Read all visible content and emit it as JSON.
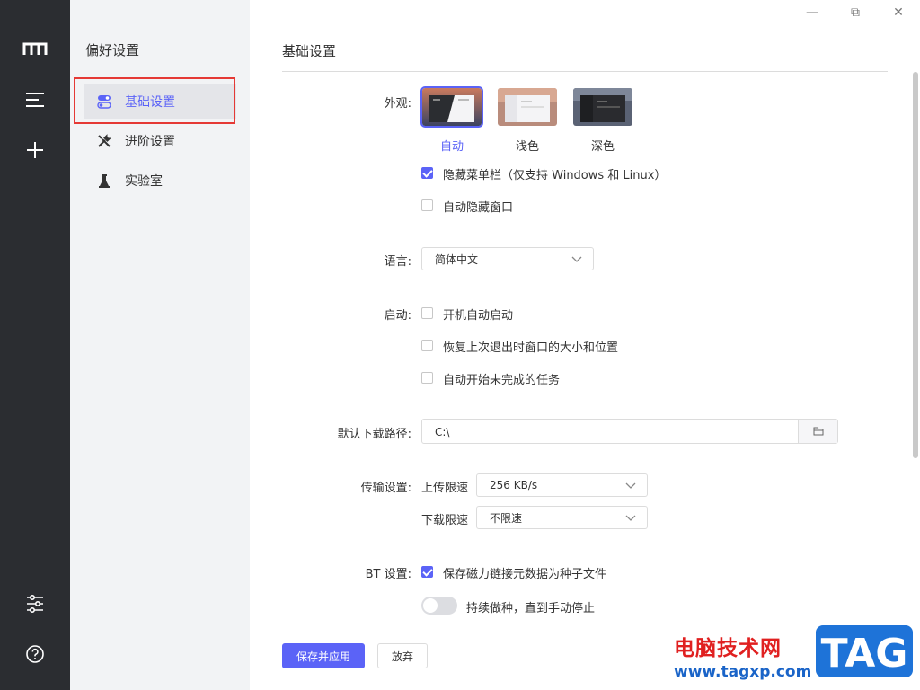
{
  "window": {
    "minimize_glyph": "—",
    "maximize_glyph": "⧉",
    "close_glyph": "✕"
  },
  "rail": {
    "icons": [
      "logo-icon",
      "menu-icon",
      "add-icon",
      "settings-sliders-icon",
      "help-icon"
    ]
  },
  "sidebar": {
    "title": "偏好设置",
    "items": [
      {
        "label": "基础设置",
        "icon": "toggle-icon",
        "active": true
      },
      {
        "label": "进阶设置",
        "icon": "tools-icon",
        "active": false
      },
      {
        "label": "实验室",
        "icon": "flask-icon",
        "active": false
      }
    ]
  },
  "main": {
    "title": "基础设置",
    "appearance": {
      "label": "外观:",
      "themes": [
        {
          "label": "自动",
          "selected": true
        },
        {
          "label": "浅色",
          "selected": false
        },
        {
          "label": "深色",
          "selected": false
        }
      ],
      "hide_menubar": {
        "label": "隐藏菜单栏（仅支持 Windows 和 Linux）",
        "checked": true
      },
      "auto_hide_window": {
        "label": "自动隐藏窗口",
        "checked": false
      }
    },
    "language": {
      "label": "语言:",
      "value": "简体中文"
    },
    "startup": {
      "label": "启动:",
      "options": [
        {
          "label": "开机自动启动",
          "checked": false
        },
        {
          "label": "恢复上次退出时窗口的大小和位置",
          "checked": false
        },
        {
          "label": "自动开始未完成的任务",
          "checked": false
        }
      ]
    },
    "download_path": {
      "label": "默认下载路径:",
      "value": "C:\\"
    },
    "transfer": {
      "label": "传输设置:",
      "upload_label": "上传限速",
      "upload_value": "256 KB/s",
      "download_label": "下载限速",
      "download_value": "不限速"
    },
    "bt": {
      "label": "BT 设置:",
      "save_magnet": {
        "label": "保存磁力链接元数据为种子文件",
        "checked": true
      },
      "keep_seeding": {
        "label": "持续做种，直到手动停止",
        "on": false
      }
    },
    "buttons": {
      "save": "保存并应用",
      "discard": "放弃"
    }
  },
  "watermark": {
    "text": "电脑技术网",
    "url": "www.tagxp.com",
    "logo": "TAG"
  },
  "colors": {
    "accent": "#5b63f7",
    "rail": "#2b2d31",
    "sidebar": "#f2f3f5",
    "highlight": "#e53935"
  }
}
